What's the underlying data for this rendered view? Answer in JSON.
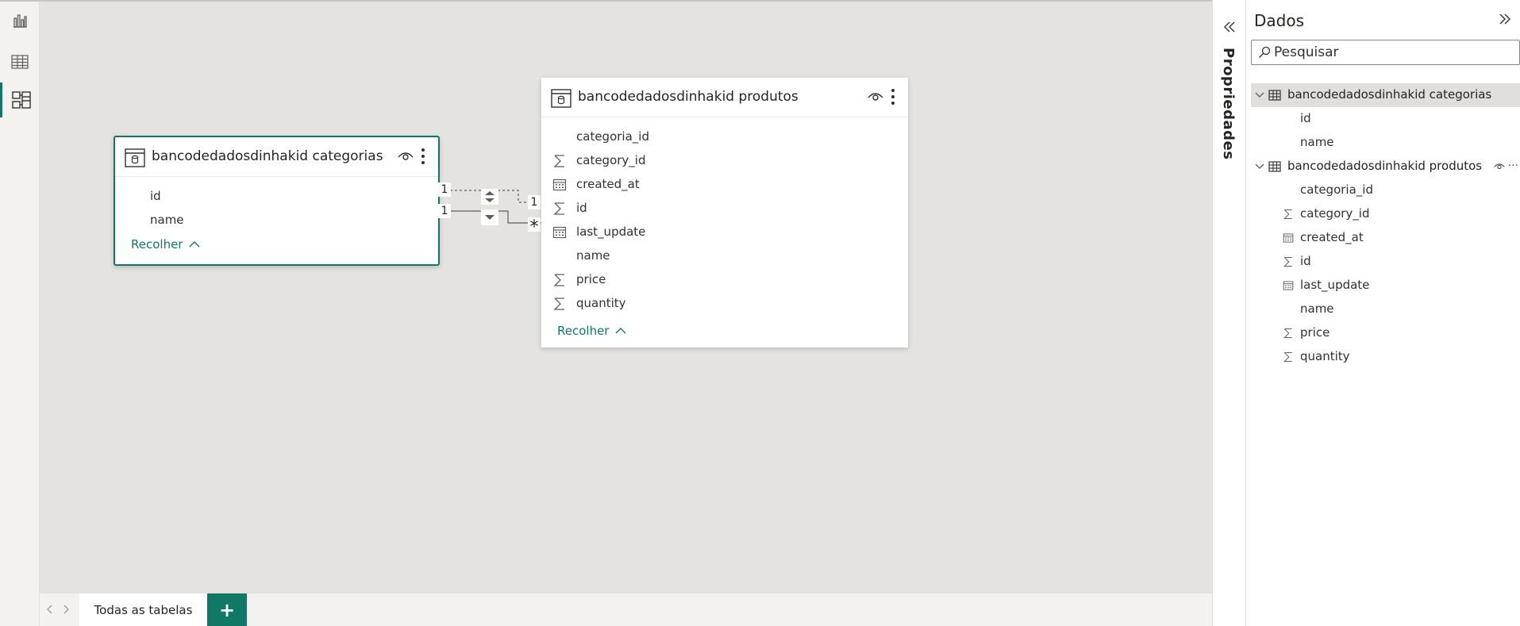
{
  "canvas": {
    "tables": [
      {
        "title": "bancodedadosdinhakid categorias",
        "fields": [
          {
            "label": "id",
            "type": "none"
          },
          {
            "label": "name",
            "type": "none"
          }
        ],
        "collapse_label": "Recolher"
      },
      {
        "title": "bancodedadosdinhakid produtos",
        "fields": [
          {
            "label": "categoria_id",
            "type": "none"
          },
          {
            "label": "category_id",
            "type": "sigma"
          },
          {
            "label": "created_at",
            "type": "calendar"
          },
          {
            "label": "id",
            "type": "sigma"
          },
          {
            "label": "last_update",
            "type": "calendar"
          },
          {
            "label": "name",
            "type": "none"
          },
          {
            "label": "price",
            "type": "sigma"
          },
          {
            "label": "quantity",
            "type": "sigma"
          }
        ],
        "collapse_label": "Recolher"
      }
    ],
    "relationships": [
      {
        "from_card": "1",
        "to_card": "1"
      },
      {
        "from_card": "1",
        "to_card": "*"
      }
    ]
  },
  "tabs": {
    "items": [
      "Todas as tabelas"
    ],
    "add_label": "+"
  },
  "properties": {
    "label": "Propriedades"
  },
  "data_pane": {
    "title": "Dados",
    "search_placeholder": "Pesquisar",
    "tables": [
      {
        "name": "bancodedadosdinhakid categorias",
        "fields": [
          {
            "label": "id",
            "type": "none"
          },
          {
            "label": "name",
            "type": "none"
          }
        ]
      },
      {
        "name": "bancodedadosdinhakid produtos",
        "fields": [
          {
            "label": "categoria_id",
            "type": "none"
          },
          {
            "label": "category_id",
            "type": "sigma"
          },
          {
            "label": "created_at",
            "type": "calendar"
          },
          {
            "label": "id",
            "type": "sigma"
          },
          {
            "label": "last_update",
            "type": "calendar"
          },
          {
            "label": "name",
            "type": "none"
          },
          {
            "label": "price",
            "type": "sigma"
          },
          {
            "label": "quantity",
            "type": "sigma"
          }
        ]
      }
    ]
  },
  "colors": {
    "accent": "#117865",
    "canvas_bg": "#e4e3e1"
  }
}
